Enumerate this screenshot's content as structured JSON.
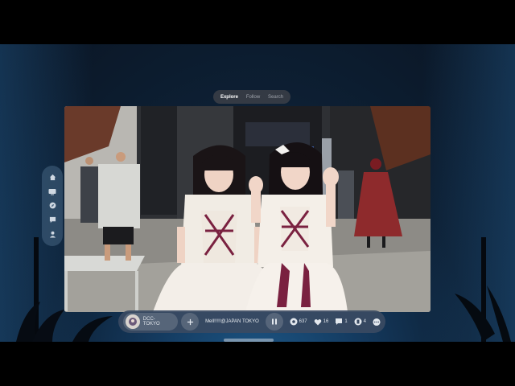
{
  "tabs": [
    {
      "label": "Explore",
      "active": true
    },
    {
      "label": "Follow",
      "active": false
    },
    {
      "label": "Search",
      "active": false
    }
  ],
  "sidebar": {
    "items": [
      {
        "icon": "home-icon"
      },
      {
        "icon": "tv-icon"
      },
      {
        "icon": "compass-icon"
      },
      {
        "icon": "chat-icon"
      },
      {
        "icon": "user-icon"
      }
    ]
  },
  "player": {
    "channel_name": "DCC-TOKYO",
    "stream_title": "Mell!!!!!@JAPAN TOKYO",
    "stats": [
      {
        "icon": "eye-icon",
        "value": "637"
      },
      {
        "icon": "heart-icon",
        "value": "16"
      },
      {
        "icon": "comment-icon",
        "value": "1"
      },
      {
        "icon": "gift-icon",
        "value": "4"
      },
      {
        "icon": "more-icon",
        "value": ""
      }
    ]
  },
  "colors": {
    "background_glow": "#1e5b8c",
    "panel": "#3a4a62",
    "text": "#dfe4ea"
  }
}
